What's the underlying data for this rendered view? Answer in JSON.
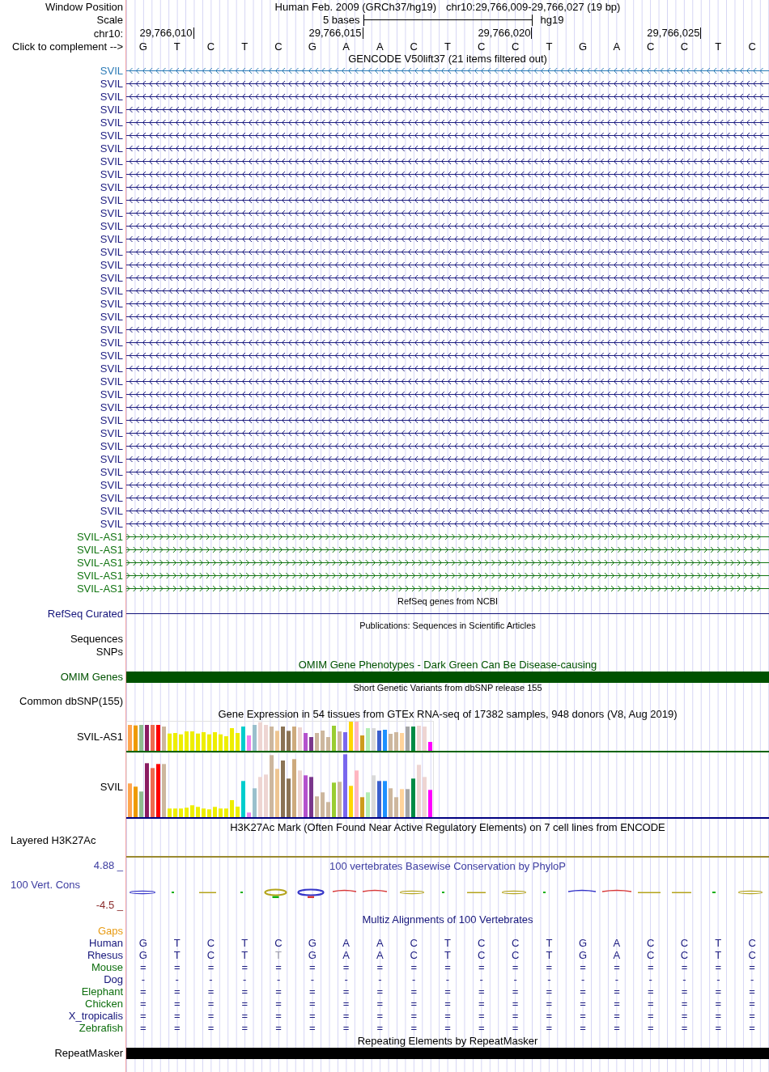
{
  "header": {
    "window_position": {
      "label": "Window Position",
      "assembly": "Human Feb. 2009 (GRCh37/hg19)",
      "position": "chr10:29,766,009-29,766,027 (19 bp)"
    },
    "scale": {
      "label": "Scale",
      "span": "5 bases",
      "assembly": "hg19"
    },
    "ruler": {
      "label": "chr10:",
      "ticks": [
        "29,766,010",
        "29,766,015",
        "29,766,020",
        "29,766,025"
      ]
    },
    "sequence": {
      "label": "Click to complement -->",
      "bases": [
        "G",
        "T",
        "C",
        "T",
        "C",
        "G",
        "A",
        "A",
        "C",
        "T",
        "C",
        "C",
        "T",
        "G",
        "A",
        "C",
        "C",
        "T",
        "C"
      ]
    }
  },
  "tracks": [
    {
      "kind": "genes",
      "title": "GENCODE V50lift37 (21 items filtered out)",
      "items": [
        {
          "label": "SVIL",
          "reverse": true,
          "color": "#2c7bb6"
        },
        {
          "label": "SVIL",
          "reverse": true,
          "color": "#1c1c80"
        },
        {
          "label": "SVIL",
          "reverse": true,
          "color": "#1c1c80"
        },
        {
          "label": "SVIL",
          "reverse": true,
          "color": "#1c1c80"
        },
        {
          "label": "SVIL",
          "reverse": true,
          "color": "#1c1c80"
        },
        {
          "label": "SVIL",
          "reverse": true,
          "color": "#1c1c80"
        },
        {
          "label": "SVIL",
          "reverse": true,
          "color": "#1c1c80"
        },
        {
          "label": "SVIL",
          "reverse": true,
          "color": "#1c1c80"
        },
        {
          "label": "SVIL",
          "reverse": true,
          "color": "#1c1c80"
        },
        {
          "label": "SVIL",
          "reverse": true,
          "color": "#1c1c80"
        },
        {
          "label": "SVIL",
          "reverse": true,
          "color": "#1c1c80"
        },
        {
          "label": "SVIL",
          "reverse": true,
          "color": "#1c1c80"
        },
        {
          "label": "SVIL",
          "reverse": true,
          "color": "#1c1c80"
        },
        {
          "label": "SVIL",
          "reverse": true,
          "color": "#1c1c80"
        },
        {
          "label": "SVIL",
          "reverse": true,
          "color": "#1c1c80"
        },
        {
          "label": "SVIL",
          "reverse": true,
          "color": "#1c1c80"
        },
        {
          "label": "SVIL",
          "reverse": true,
          "color": "#1c1c80"
        },
        {
          "label": "SVIL",
          "reverse": true,
          "color": "#1c1c80"
        },
        {
          "label": "SVIL",
          "reverse": true,
          "color": "#1c1c80"
        },
        {
          "label": "SVIL",
          "reverse": true,
          "color": "#1c1c80"
        },
        {
          "label": "SVIL",
          "reverse": true,
          "color": "#1c1c80"
        },
        {
          "label": "SVIL",
          "reverse": true,
          "color": "#1c1c80"
        },
        {
          "label": "SVIL",
          "reverse": true,
          "color": "#1c1c80"
        },
        {
          "label": "SVIL",
          "reverse": true,
          "color": "#1c1c80"
        },
        {
          "label": "SVIL",
          "reverse": true,
          "color": "#1c1c80"
        },
        {
          "label": "SVIL",
          "reverse": true,
          "color": "#1c1c80"
        },
        {
          "label": "SVIL",
          "reverse": true,
          "color": "#1c1c80"
        },
        {
          "label": "SVIL",
          "reverse": true,
          "color": "#1c1c80"
        },
        {
          "label": "SVIL",
          "reverse": true,
          "color": "#1c1c80"
        },
        {
          "label": "SVIL",
          "reverse": true,
          "color": "#1c1c80"
        },
        {
          "label": "SVIL",
          "reverse": true,
          "color": "#1c1c80"
        },
        {
          "label": "SVIL",
          "reverse": true,
          "color": "#1c1c80"
        },
        {
          "label": "SVIL",
          "reverse": true,
          "color": "#1c1c80"
        },
        {
          "label": "SVIL",
          "reverse": true,
          "color": "#1c1c80"
        },
        {
          "label": "SVIL",
          "reverse": true,
          "color": "#1c1c80"
        },
        {
          "label": "SVIL",
          "reverse": true,
          "color": "#1c1c80"
        },
        {
          "label": "SVIL-AS1",
          "reverse": false,
          "color": "#127512"
        },
        {
          "label": "SVIL-AS1",
          "reverse": false,
          "color": "#127512"
        },
        {
          "label": "SVIL-AS1",
          "reverse": false,
          "color": "#127512"
        },
        {
          "label": "SVIL-AS1",
          "reverse": false,
          "color": "#127512"
        },
        {
          "label": "SVIL-AS1",
          "reverse": false,
          "color": "#127512"
        }
      ]
    },
    {
      "kind": "line",
      "title": "RefSeq genes from NCBI",
      "label": "RefSeq Curated",
      "color": "#14147a"
    },
    {
      "kind": "labels",
      "title": "Publications: Sequences in Scientific Articles",
      "labels": [
        "Sequences",
        "SNPs"
      ]
    },
    {
      "kind": "bar",
      "title": "OMIM Gene Phenotypes - Dark Green Can Be Disease-causing",
      "label": "OMIM Genes",
      "color": "#005200"
    },
    {
      "kind": "labels",
      "title": "Short Genetic Variants from dbSNP release 155",
      "labels": [
        "Common dbSNP(155)"
      ]
    },
    {
      "kind": "expression",
      "title": "Gene Expression in 54 tissues from GTEx RNA-seq of 17382 samples, 948 donors (V8, Aug 2019)",
      "genes": [
        {
          "label": "SVIL-AS1",
          "color": "#006400"
        },
        {
          "label": "SVIL",
          "color": "#000080"
        }
      ]
    },
    {
      "kind": "signal",
      "title": "H3K27Ac Mark (Often Found Near Active Regulatory Elements) on 7 cell lines from ENCODE",
      "label": "Layered H3K27Ac",
      "color": "#9a8a30"
    },
    {
      "kind": "conservation",
      "title": "100 vertebrates Basewise Conservation by PhyloP",
      "label": "100 Vert. Cons",
      "color": "#3c3ca0",
      "max": "4.88 _",
      "min": "-4.5 _"
    },
    {
      "kind": "alignment",
      "title": "Multiz Alignments of 100 Vertebrates",
      "color": "#14147a",
      "rows": [
        {
          "species": "Gaps",
          "color": "#e89a10"
        },
        {
          "species": "Human",
          "color": "#14147a",
          "bases": [
            {
              "base": "G",
              "mismatch": false
            },
            {
              "base": "T",
              "mismatch": false
            },
            {
              "base": "C",
              "mismatch": false
            },
            {
              "base": "T",
              "mismatch": false
            },
            {
              "base": "C",
              "mismatch": false
            },
            {
              "base": "G",
              "mismatch": false
            },
            {
              "base": "A",
              "mismatch": false
            },
            {
              "base": "A",
              "mismatch": false
            },
            {
              "base": "C",
              "mismatch": false
            },
            {
              "base": "T",
              "mismatch": false
            },
            {
              "base": "C",
              "mismatch": false
            },
            {
              "base": "C",
              "mismatch": false
            },
            {
              "base": "T",
              "mismatch": false
            },
            {
              "base": "G",
              "mismatch": false
            },
            {
              "base": "A",
              "mismatch": false
            },
            {
              "base": "C",
              "mismatch": false
            },
            {
              "base": "C",
              "mismatch": false
            },
            {
              "base": "T",
              "mismatch": false
            },
            {
              "base": "C",
              "mismatch": false
            }
          ]
        },
        {
          "species": "Rhesus",
          "color": "#14147a",
          "bases": [
            {
              "base": "G",
              "mismatch": false
            },
            {
              "base": "T",
              "mismatch": false
            },
            {
              "base": "C",
              "mismatch": false
            },
            {
              "base": "T",
              "mismatch": false
            },
            {
              "base": "T",
              "mismatch": true
            },
            {
              "base": "G",
              "mismatch": false
            },
            {
              "base": "A",
              "mismatch": false
            },
            {
              "base": "A",
              "mismatch": false
            },
            {
              "base": "C",
              "mismatch": false
            },
            {
              "base": "T",
              "mismatch": false
            },
            {
              "base": "C",
              "mismatch": false
            },
            {
              "base": "C",
              "mismatch": false
            },
            {
              "base": "T",
              "mismatch": false
            },
            {
              "base": "G",
              "mismatch": false
            },
            {
              "base": "A",
              "mismatch": false
            },
            {
              "base": "C",
              "mismatch": false
            },
            {
              "base": "C",
              "mismatch": false
            },
            {
              "base": "T",
              "mismatch": false
            },
            {
              "base": "C",
              "mismatch": false
            }
          ]
        },
        {
          "species": "Mouse",
          "color": "#0e6e0e",
          "bases": [
            {
              "base": "=",
              "mismatch": false
            },
            {
              "base": "=",
              "mismatch": false
            },
            {
              "base": "=",
              "mismatch": false
            },
            {
              "base": "=",
              "mismatch": false
            },
            {
              "base": "=",
              "mismatch": false
            },
            {
              "base": "=",
              "mismatch": false
            },
            {
              "base": "=",
              "mismatch": false
            },
            {
              "base": "=",
              "mismatch": false
            },
            {
              "base": "=",
              "mismatch": false
            },
            {
              "base": "=",
              "mismatch": false
            },
            {
              "base": "=",
              "mismatch": false
            },
            {
              "base": "=",
              "mismatch": false
            },
            {
              "base": "=",
              "mismatch": false
            },
            {
              "base": "=",
              "mismatch": false
            },
            {
              "base": "=",
              "mismatch": false
            },
            {
              "base": "=",
              "mismatch": false
            },
            {
              "base": "=",
              "mismatch": false
            },
            {
              "base": "=",
              "mismatch": false
            },
            {
              "base": "=",
              "mismatch": false
            }
          ]
        },
        {
          "species": "Dog",
          "color": "#14147a",
          "bases": [
            {
              "base": "-",
              "mismatch": false
            },
            {
              "base": "-",
              "mismatch": false
            },
            {
              "base": "-",
              "mismatch": false
            },
            {
              "base": "-",
              "mismatch": false
            },
            {
              "base": "-",
              "mismatch": false
            },
            {
              "base": "-",
              "mismatch": false
            },
            {
              "base": "-",
              "mismatch": false
            },
            {
              "base": "-",
              "mismatch": false
            },
            {
              "base": "-",
              "mismatch": false
            },
            {
              "base": "-",
              "mismatch": false
            },
            {
              "base": "-",
              "mismatch": false
            },
            {
              "base": "-",
              "mismatch": false
            },
            {
              "base": "-",
              "mismatch": false
            },
            {
              "base": "-",
              "mismatch": false
            },
            {
              "base": "-",
              "mismatch": false
            },
            {
              "base": "-",
              "mismatch": false
            },
            {
              "base": "-",
              "mismatch": false
            },
            {
              "base": "-",
              "mismatch": false
            },
            {
              "base": "-",
              "mismatch": false
            }
          ]
        },
        {
          "species": "Elephant",
          "color": "#0e6e0e",
          "bases": [
            {
              "base": "=",
              "mismatch": false
            },
            {
              "base": "=",
              "mismatch": false
            },
            {
              "base": "=",
              "mismatch": false
            },
            {
              "base": "=",
              "mismatch": false
            },
            {
              "base": "=",
              "mismatch": false
            },
            {
              "base": "=",
              "mismatch": false
            },
            {
              "base": "=",
              "mismatch": false
            },
            {
              "base": "=",
              "mismatch": false
            },
            {
              "base": "=",
              "mismatch": false
            },
            {
              "base": "=",
              "mismatch": false
            },
            {
              "base": "=",
              "mismatch": false
            },
            {
              "base": "=",
              "mismatch": false
            },
            {
              "base": "=",
              "mismatch": false
            },
            {
              "base": "=",
              "mismatch": false
            },
            {
              "base": "=",
              "mismatch": false
            },
            {
              "base": "=",
              "mismatch": false
            },
            {
              "base": "=",
              "mismatch": false
            },
            {
              "base": "=",
              "mismatch": false
            },
            {
              "base": "=",
              "mismatch": false
            }
          ]
        },
        {
          "species": "Chicken",
          "color": "#0e6e0e",
          "bases": [
            {
              "base": "=",
              "mismatch": false
            },
            {
              "base": "=",
              "mismatch": false
            },
            {
              "base": "=",
              "mismatch": false
            },
            {
              "base": "=",
              "mismatch": false
            },
            {
              "base": "=",
              "mismatch": false
            },
            {
              "base": "=",
              "mismatch": false
            },
            {
              "base": "=",
              "mismatch": false
            },
            {
              "base": "=",
              "mismatch": false
            },
            {
              "base": "=",
              "mismatch": false
            },
            {
              "base": "=",
              "mismatch": false
            },
            {
              "base": "=",
              "mismatch": false
            },
            {
              "base": "=",
              "mismatch": false
            },
            {
              "base": "=",
              "mismatch": false
            },
            {
              "base": "=",
              "mismatch": false
            },
            {
              "base": "=",
              "mismatch": false
            },
            {
              "base": "=",
              "mismatch": false
            },
            {
              "base": "=",
              "mismatch": false
            },
            {
              "base": "=",
              "mismatch": false
            },
            {
              "base": "=",
              "mismatch": false
            }
          ]
        },
        {
          "species": "X_tropicalis",
          "color": "#14147a",
          "bases": [
            {
              "base": "=",
              "mismatch": false
            },
            {
              "base": "=",
              "mismatch": false
            },
            {
              "base": "=",
              "mismatch": false
            },
            {
              "base": "=",
              "mismatch": false
            },
            {
              "base": "=",
              "mismatch": false
            },
            {
              "base": "=",
              "mismatch": false
            },
            {
              "base": "=",
              "mismatch": false
            },
            {
              "base": "=",
              "mismatch": false
            },
            {
              "base": "=",
              "mismatch": false
            },
            {
              "base": "=",
              "mismatch": false
            },
            {
              "base": "=",
              "mismatch": false
            },
            {
              "base": "=",
              "mismatch": false
            },
            {
              "base": "=",
              "mismatch": false
            },
            {
              "base": "=",
              "mismatch": false
            },
            {
              "base": "=",
              "mismatch": false
            },
            {
              "base": "=",
              "mismatch": false
            },
            {
              "base": "=",
              "mismatch": false
            },
            {
              "base": "=",
              "mismatch": false
            },
            {
              "base": "=",
              "mismatch": false
            }
          ]
        },
        {
          "species": "Zebrafish",
          "color": "#0e6e0e",
          "bases": [
            {
              "base": "=",
              "mismatch": false
            },
            {
              "base": "=",
              "mismatch": false
            },
            {
              "base": "=",
              "mismatch": false
            },
            {
              "base": "=",
              "mismatch": false
            },
            {
              "base": "=",
              "mismatch": false
            },
            {
              "base": "=",
              "mismatch": false
            },
            {
              "base": "=",
              "mismatch": false
            },
            {
              "base": "=",
              "mismatch": false
            },
            {
              "base": "=",
              "mismatch": false
            },
            {
              "base": "=",
              "mismatch": false
            },
            {
              "base": "=",
              "mismatch": false
            },
            {
              "base": "=",
              "mismatch": false
            },
            {
              "base": "=",
              "mismatch": false
            },
            {
              "base": "=",
              "mismatch": false
            },
            {
              "base": "=",
              "mismatch": false
            },
            {
              "base": "=",
              "mismatch": false
            },
            {
              "base": "=",
              "mismatch": false
            },
            {
              "base": "=",
              "mismatch": false
            },
            {
              "base": "=",
              "mismatch": false
            }
          ]
        }
      ]
    },
    {
      "kind": "bar",
      "title": "Repeating Elements by RepeatMasker",
      "label": "RepeatMasker",
      "color": "#000000"
    }
  ]
}
